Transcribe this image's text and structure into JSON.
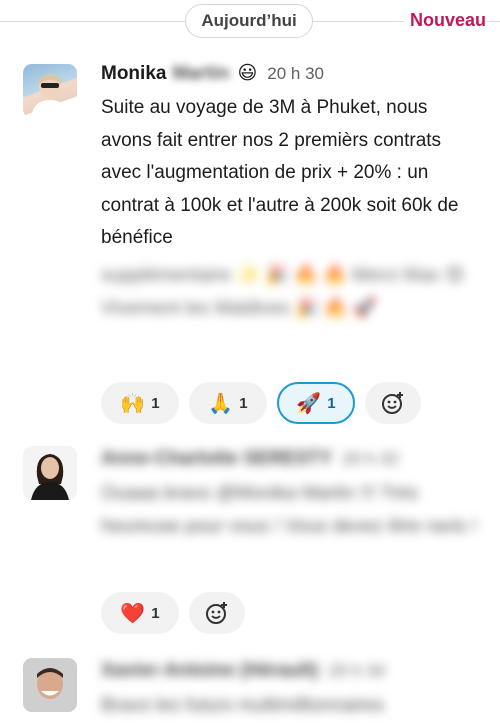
{
  "header": {
    "day_label": "Aujourd’hui",
    "new_label": "Nouveau"
  },
  "messages": [
    {
      "author_first": "Monika",
      "author_last": "Martin",
      "status_emoji": "😃",
      "time": "20 h 30",
      "text": "Suite au voyage de 3M à Phuket, nous avons fait entrer nos 2 premièrs contrats avec l'augmentation de prix + 20% : un contrat à 100k et l'autre à 200k soit 60k de bénéfice",
      "blurred_text": "supplémentaire ✨ 🎉 🔥 🔥 Merci Max 😍 Vivement les Maldives 🎉 🔥 🚀",
      "reactions": [
        {
          "emoji": "🙌",
          "count": "1"
        },
        {
          "emoji": "🙏",
          "count": "1"
        },
        {
          "emoji": "🚀",
          "count": "1"
        }
      ]
    },
    {
      "author": "Anne-Charlotte SERESTY",
      "time": "20 h 32",
      "text": "Ouaaa bravo @Monika Martin !!! Très heureuse pour vous ! Vous devez être ravis !",
      "reactions": [
        {
          "emoji": "❤️",
          "count": "1"
        }
      ]
    },
    {
      "author": "Xavier-Antoine (Hérault)",
      "time": "20 h 34",
      "text": "Bravo les futurs multimillionnaires"
    }
  ],
  "icons": {
    "add_reaction": "add-reaction-icon"
  },
  "colors": {
    "accent_new": "#c2185b",
    "active_reaction_border": "#1d9bd1"
  }
}
